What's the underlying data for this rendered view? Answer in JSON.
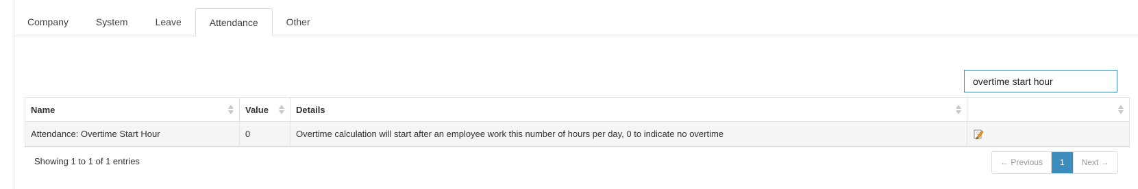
{
  "tabs": [
    {
      "label": "Company"
    },
    {
      "label": "System"
    },
    {
      "label": "Leave"
    },
    {
      "label": "Attendance",
      "active": true
    },
    {
      "label": "Other"
    }
  ],
  "search": {
    "value": "overtime start hour"
  },
  "table": {
    "columns": [
      "Name",
      "Value",
      "Details",
      ""
    ],
    "rows": [
      {
        "name": "Attendance: Overtime Start Hour",
        "value": "0",
        "details": "Overtime calculation will start after an employee work this number of hours per day, 0 to indicate no overtime",
        "action_icon": "edit-icon"
      }
    ]
  },
  "footer": {
    "info": "Showing 1 to 1 of 1 entries",
    "prev": "← Previous",
    "page": "1",
    "next": "Next →"
  },
  "colors": {
    "accent": "#3c8dbc",
    "row_bg": "#f5f5f5",
    "border": "#e3e3e3"
  }
}
